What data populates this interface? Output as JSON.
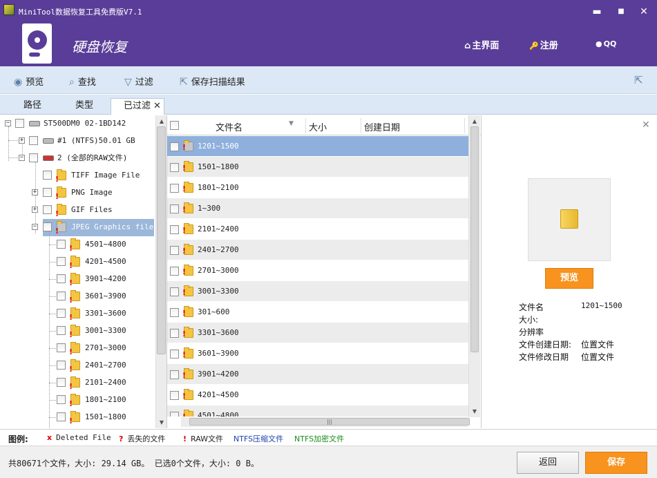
{
  "window": {
    "title": "MiniTool数据恢复工具免费版V7.1",
    "minimize": "▬",
    "maximize": "■",
    "close": "✕"
  },
  "header": {
    "title": "硬盘恢复",
    "nav": [
      {
        "icon": "⌂",
        "label": "主界面"
      },
      {
        "icon": "🔑",
        "label": "注册"
      },
      {
        "icon": "●",
        "label": "QQ"
      }
    ]
  },
  "toolbar": {
    "items": [
      {
        "icon": "◉",
        "label": "预览"
      },
      {
        "icon": "⌕",
        "label": "查找"
      },
      {
        "icon": "▽",
        "label": "过滤"
      },
      {
        "icon": "⇱",
        "label": "保存扫描结果"
      }
    ]
  },
  "tabs": [
    {
      "label": "路径"
    },
    {
      "label": "类型"
    },
    {
      "label": "已过滤",
      "close": "✕"
    }
  ],
  "tree": {
    "root": "ST500DM0 02-1BD142",
    "items": [
      {
        "label": "#1 (NTFS)50.01 GB"
      },
      {
        "label": "2 (全部的RAW文件)"
      },
      {
        "label": "TIFF Image File"
      },
      {
        "label": "PNG Image"
      },
      {
        "label": "GIF Files"
      },
      {
        "label": "JPEG Graphics file"
      },
      {
        "label": "4501~4800"
      },
      {
        "label": "4201~4500"
      },
      {
        "label": "3901~4200"
      },
      {
        "label": "3601~3900"
      },
      {
        "label": "3301~3600"
      },
      {
        "label": "3001~3300"
      },
      {
        "label": "2701~3000"
      },
      {
        "label": "2401~2700"
      },
      {
        "label": "2101~2400"
      },
      {
        "label": "1801~2100"
      },
      {
        "label": "1501~1800"
      }
    ]
  },
  "filelist": {
    "columns": {
      "name": "文件名",
      "size": "大小",
      "created": "创建日期"
    },
    "rows": [
      "1201~1500",
      "1501~1800",
      "1801~2100",
      "1~300",
      "2101~2400",
      "2401~2700",
      "2701~3000",
      "3001~3300",
      "301~600",
      "3301~3600",
      "3601~3900",
      "3901~4200",
      "4201~4500",
      "4501~4800"
    ]
  },
  "preview": {
    "button": "预览",
    "close": "✕",
    "info": [
      {
        "label": "文件名",
        "value": "1201~1500"
      },
      {
        "label": "大小:",
        "value": ""
      },
      {
        "label": "分辨率",
        "value": ""
      },
      {
        "label": "文件创建日期:",
        "value": "位置文件"
      },
      {
        "label": "文件修改日期",
        "value": "位置文件"
      }
    ]
  },
  "legend": {
    "title": "图例:",
    "items": [
      {
        "mark": "x",
        "label": "Deleted File",
        "color": "#d00000"
      },
      {
        "mark": "?",
        "label": "丢失的文件",
        "color": "#d00000"
      },
      {
        "mark": "!",
        "label": "RAW文件",
        "color": "#d00000"
      },
      {
        "mark": "",
        "label": "NTFS压缩文件",
        "color": "#1a3fb0"
      },
      {
        "mark": "",
        "label": "NTFS加密文件",
        "color": "#1a8a1a"
      }
    ]
  },
  "status": {
    "text": "共80671个文件，大小: 29.14 GB。 已选0个文件，大小: 0 B。"
  },
  "buttons": {
    "back": "返回",
    "save": "保存"
  },
  "colors": {
    "header_bg": "#5a3d98",
    "toolbar_bg": "#dce8f5",
    "accent": "#f7931e",
    "selection": "#8fb0dc"
  }
}
